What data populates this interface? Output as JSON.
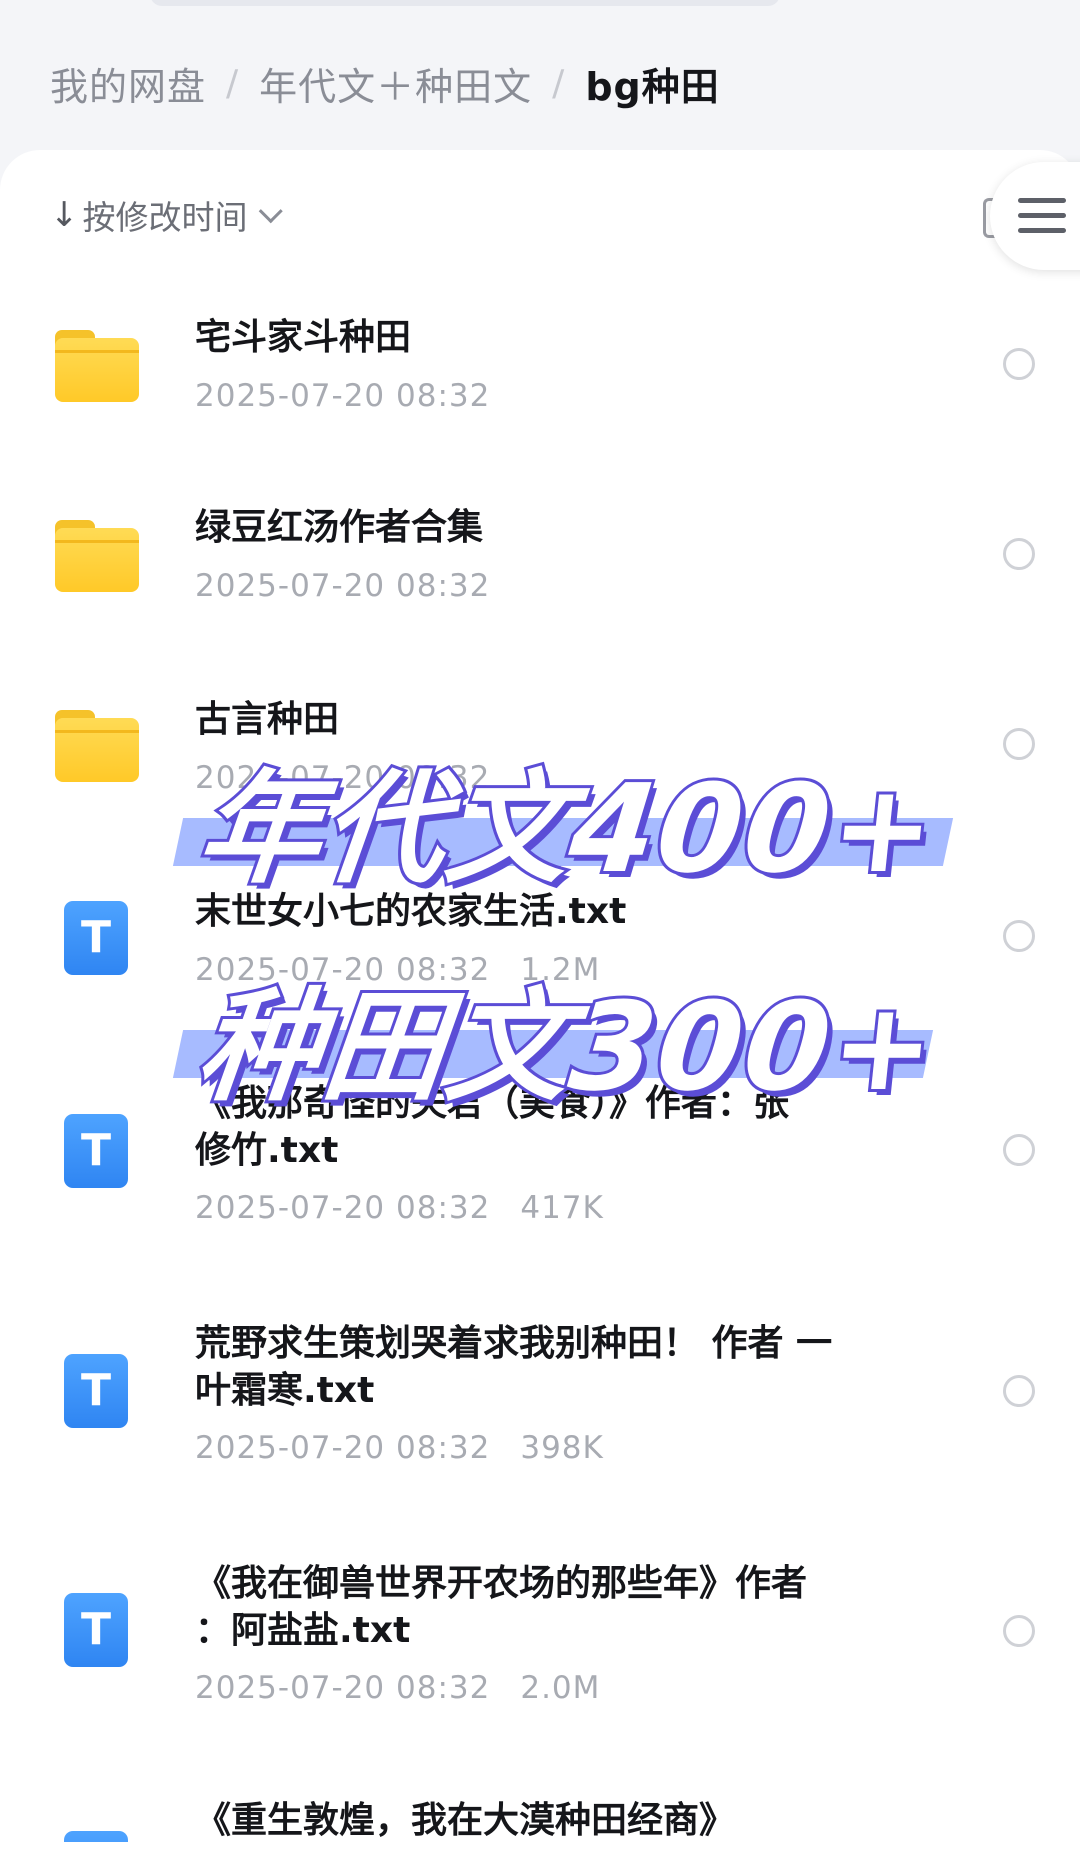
{
  "breadcrumb": {
    "items": [
      "我的网盘",
      "年代文＋种田文",
      "bg种田"
    ],
    "separator": "/"
  },
  "sort": {
    "arrow": "↓",
    "label": "按修改时间"
  },
  "files": [
    {
      "type": "folder",
      "name": "宅斗家斗种田",
      "date": "2025-07-20 08:32",
      "size": ""
    },
    {
      "type": "folder",
      "name": "绿豆红汤作者合集",
      "date": "2025-07-20 08:32",
      "size": ""
    },
    {
      "type": "folder",
      "name": "古言种田",
      "date": "2025-07-20 08:32",
      "size": ""
    },
    {
      "type": "txt",
      "name": "末世女小七的农家生活.txt",
      "date": "2025-07-20 08:32",
      "size": "1.2M"
    },
    {
      "type": "txt",
      "name_line1": "《我那奇怪的夫君（美食）》作者：张",
      "name_line2": "修竹.txt",
      "date": "2025-07-20 08:32",
      "size": "417K"
    },
    {
      "type": "txt",
      "name_line1": "荒野求生策划哭着求我别种田！ 作者 一",
      "name_line2": "叶霜寒.txt",
      "date": "2025-07-20 08:32",
      "size": "398K"
    },
    {
      "type": "txt",
      "name_line1": "《我在御兽世界开农场的那些年》作者",
      "name_line2": "：阿盐盐.txt",
      "date": "2025-07-20 08:32",
      "size": "2.0M"
    },
    {
      "type": "txt",
      "name_line1": "《重生敦煌，我在大漠种田经商》",
      "date": "",
      "size": ""
    }
  ],
  "icons": {
    "txt_letter": "T",
    "folder": "folder-icon",
    "menu": "menu-icon",
    "radio": "radio-circle-icon"
  },
  "promo": {
    "line1": "年代文400+",
    "line2": "种田文300+"
  },
  "colors": {
    "accent_blue": "#3a8ff7",
    "folder_yellow": "#ffc928",
    "promo_stroke": "#5b4dd6",
    "promo_band": "#8aa4ff"
  }
}
